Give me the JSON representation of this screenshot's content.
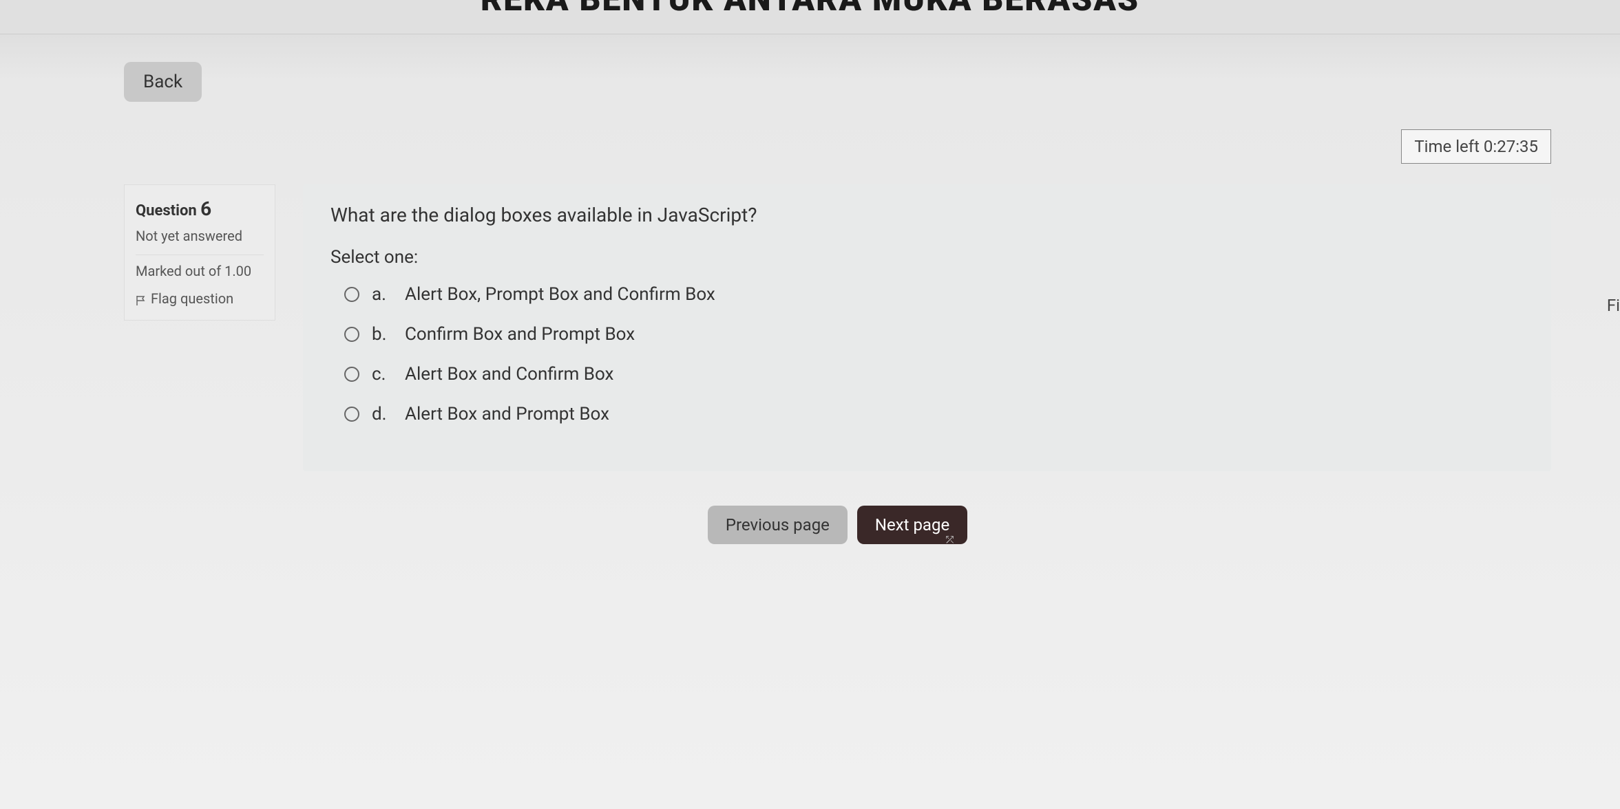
{
  "header": {
    "partial_title": "REKA BENTUK ANTARA MUKA BERASAS"
  },
  "navigation": {
    "back_label": "Back",
    "previous_label": "Previous page",
    "next_label": "Next page"
  },
  "timer": {
    "label": "Time left 0:27:35"
  },
  "right_edge": {
    "partial_text": "Fi"
  },
  "question": {
    "label_prefix": "Question",
    "number": "6",
    "status": "Not yet answered",
    "marks": "Marked out of 1.00",
    "flag_label": "Flag question",
    "text": "What are the dialog boxes available in JavaScript?",
    "select_prompt": "Select one:",
    "options": [
      {
        "letter": "a.",
        "text": "Alert Box, Prompt Box and Confirm Box"
      },
      {
        "letter": "b.",
        "text": "Confirm Box and Prompt Box"
      },
      {
        "letter": "c.",
        "text": "Alert Box and Confirm Box"
      },
      {
        "letter": "d.",
        "text": "Alert Box and Prompt Box"
      }
    ]
  }
}
